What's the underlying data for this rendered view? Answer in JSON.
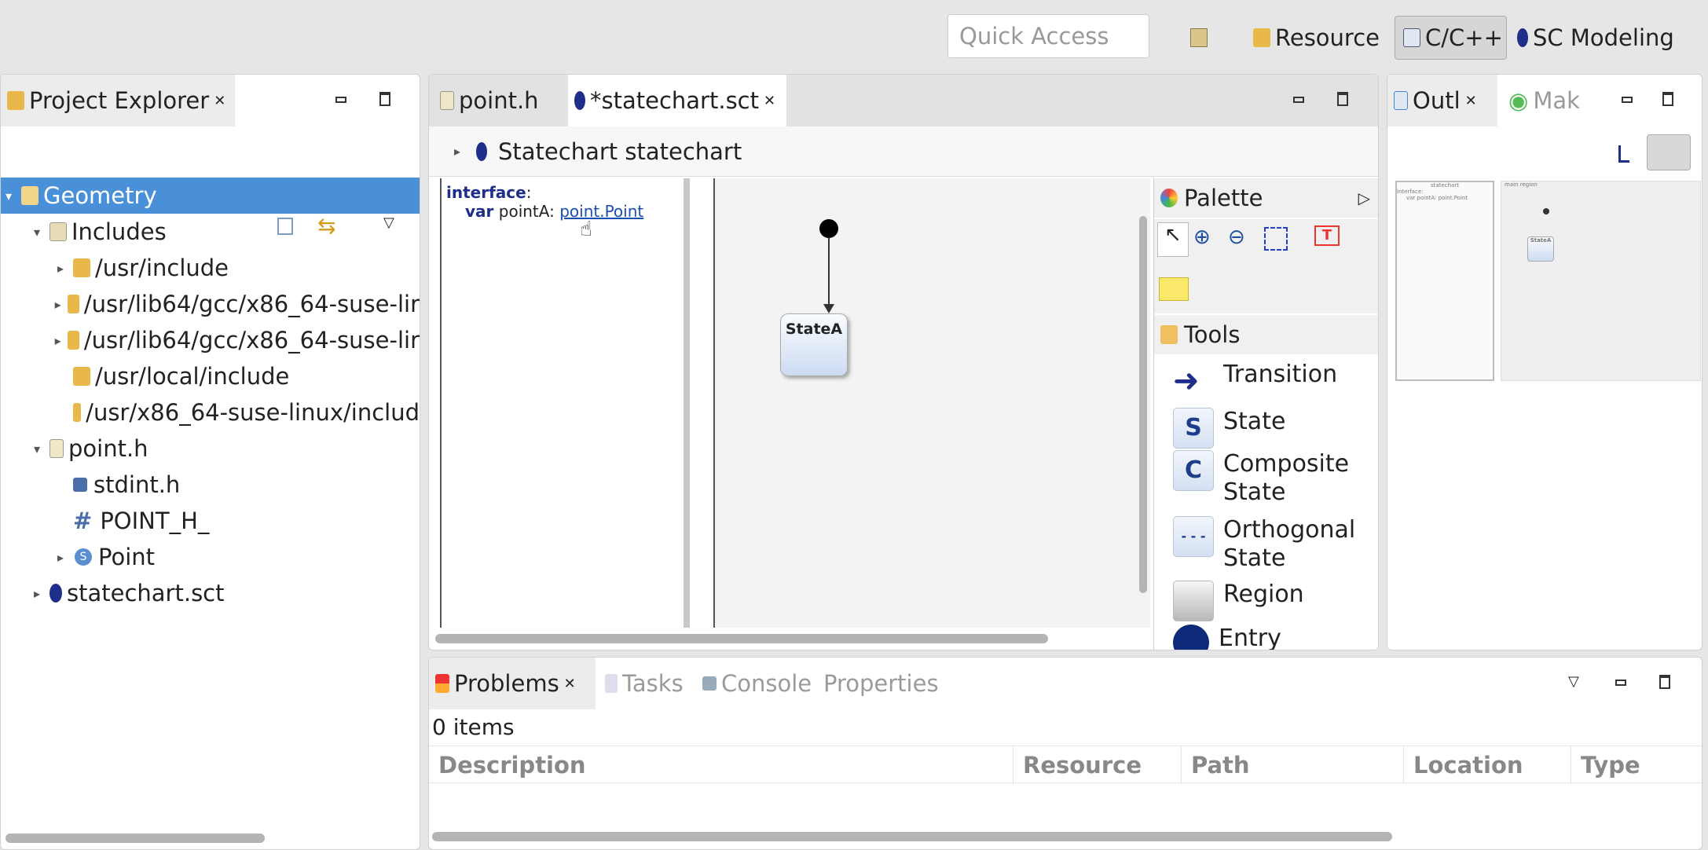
{
  "toolbar": {
    "quick_access_placeholder": "Quick Access",
    "perspectives": [
      {
        "label": "Resource",
        "active": false
      },
      {
        "label": "C/C++",
        "active": true
      },
      {
        "label": "SC Modeling",
        "active": false
      }
    ]
  },
  "project_explorer": {
    "title": "Project Explorer",
    "tree": [
      {
        "label": "Geometry",
        "selected": true
      },
      {
        "label": "Includes"
      },
      {
        "label": "/usr/include"
      },
      {
        "label": "/usr/lib64/gcc/x86_64-suse-lir"
      },
      {
        "label": "/usr/lib64/gcc/x86_64-suse-lir"
      },
      {
        "label": "/usr/local/include"
      },
      {
        "label": "/usr/x86_64-suse-linux/includ"
      },
      {
        "label": "point.h"
      },
      {
        "label": "stdint.h"
      },
      {
        "label": "POINT_H_"
      },
      {
        "label": "Point"
      },
      {
        "label": "statechart.sct"
      }
    ]
  },
  "editor": {
    "tabs": [
      {
        "label": "point.h",
        "active": false
      },
      {
        "label": "*statechart.sct",
        "active": true
      }
    ],
    "breadcrumb": "Statechart statechart",
    "definition": {
      "keyword": "interface",
      "colon": ":",
      "var_kw": "var",
      "var_name": "pointA:",
      "type_link": "point.Point"
    },
    "diagram": {
      "state_name": "StateA"
    },
    "palette": {
      "title": "Palette",
      "drawer": "Tools",
      "items": [
        "Transition",
        "State",
        "Composite State",
        "Orthogonal State",
        "Region",
        "Entry"
      ],
      "icon_letters": [
        "S",
        "C",
        "- - -"
      ]
    }
  },
  "outline": {
    "tabs": [
      {
        "label": "Outl",
        "active": true
      },
      {
        "label": "Mak",
        "active": false
      }
    ],
    "thumb": {
      "left_title": "statechart",
      "right_title": "main region",
      "interface": "interface:",
      "var_line": "var pointA: point.Point",
      "state": "StateA"
    }
  },
  "problems": {
    "tabs": [
      {
        "label": "Problems",
        "active": true
      },
      {
        "label": "Tasks"
      },
      {
        "label": "Console"
      },
      {
        "label": "Properties"
      }
    ],
    "count": "0 items",
    "columns": [
      "Description",
      "Resource",
      "Path",
      "Location",
      "Type"
    ]
  },
  "colors": {
    "selection": "#4a90d9",
    "link": "#1a4fb4",
    "keyword": "#1d2f8a",
    "entry": "#0d2a7a"
  }
}
